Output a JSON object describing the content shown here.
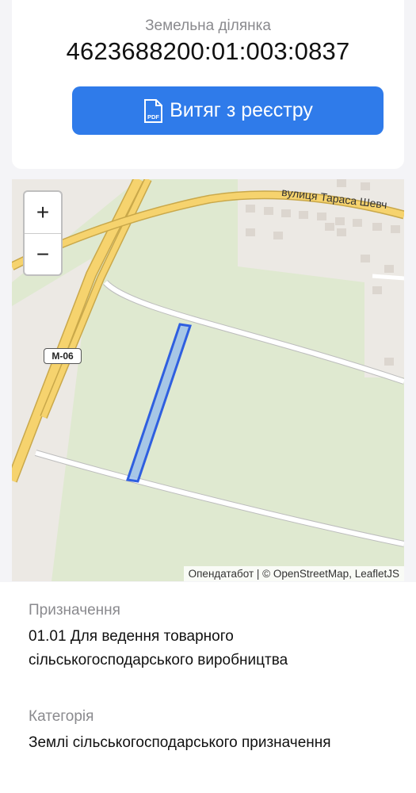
{
  "header": {
    "subtitle": "Земельна ділянка",
    "cadastral_number": "4623688200:01:003:0837",
    "extract_button_label": "Витяг з реєстру",
    "pdf_icon_text": "PDF"
  },
  "map": {
    "zoom_in": "+",
    "zoom_out": "−",
    "street_label": "вулиця Тараса Шевч",
    "highway_shield": "М-06",
    "attribution_osm_ua": "Опендатабот",
    "attribution_sep": " | © ",
    "attribution_osm": "OpenStreetMap",
    "attribution_leaflet": "LeafletJS"
  },
  "details": {
    "purpose_label": "Призначення",
    "purpose_line1": "01.01 Для ведення товарного",
    "purpose_line2": "сільськогосподарського виробництва",
    "category_label": "Категорія",
    "category_value": "Землі сільськогосподарського призначення"
  },
  "colors": {
    "accent": "#2f7bea",
    "parcel_stroke": "#2f5fe0",
    "parcel_fill": "#9ec1ea"
  }
}
